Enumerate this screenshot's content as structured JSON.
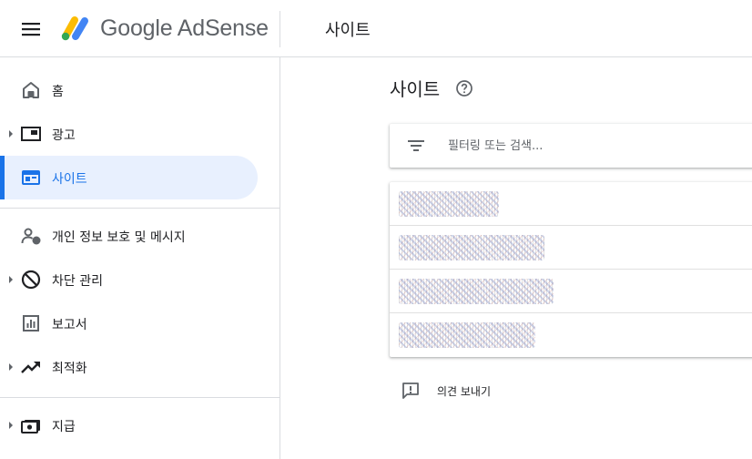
{
  "header": {
    "brand": "Google AdSense",
    "page_title": "사이트"
  },
  "sidebar": {
    "items": [
      {
        "label": "홈",
        "icon": "home-icon"
      },
      {
        "label": "광고",
        "icon": "ads-icon",
        "expandable": true
      },
      {
        "label": "사이트",
        "icon": "sites-icon",
        "active": true
      },
      {
        "label": "개인 정보 보호 및 메시지",
        "icon": "privacy-messaging-icon"
      },
      {
        "label": "차단 관리",
        "icon": "block-icon",
        "expandable": true
      },
      {
        "label": "보고서",
        "icon": "reports-icon"
      },
      {
        "label": "최적화",
        "icon": "trending-up-icon",
        "expandable": true
      },
      {
        "label": "지급",
        "icon": "payments-icon",
        "expandable": true
      }
    ]
  },
  "main": {
    "title": "사이트",
    "filter_placeholder": "필터링 또는 검색...",
    "feedback_label": "의견 보내기"
  },
  "colors": {
    "accent": "#1a73e8",
    "active_bg": "#e8f0fe",
    "icon": "#5f6368"
  }
}
